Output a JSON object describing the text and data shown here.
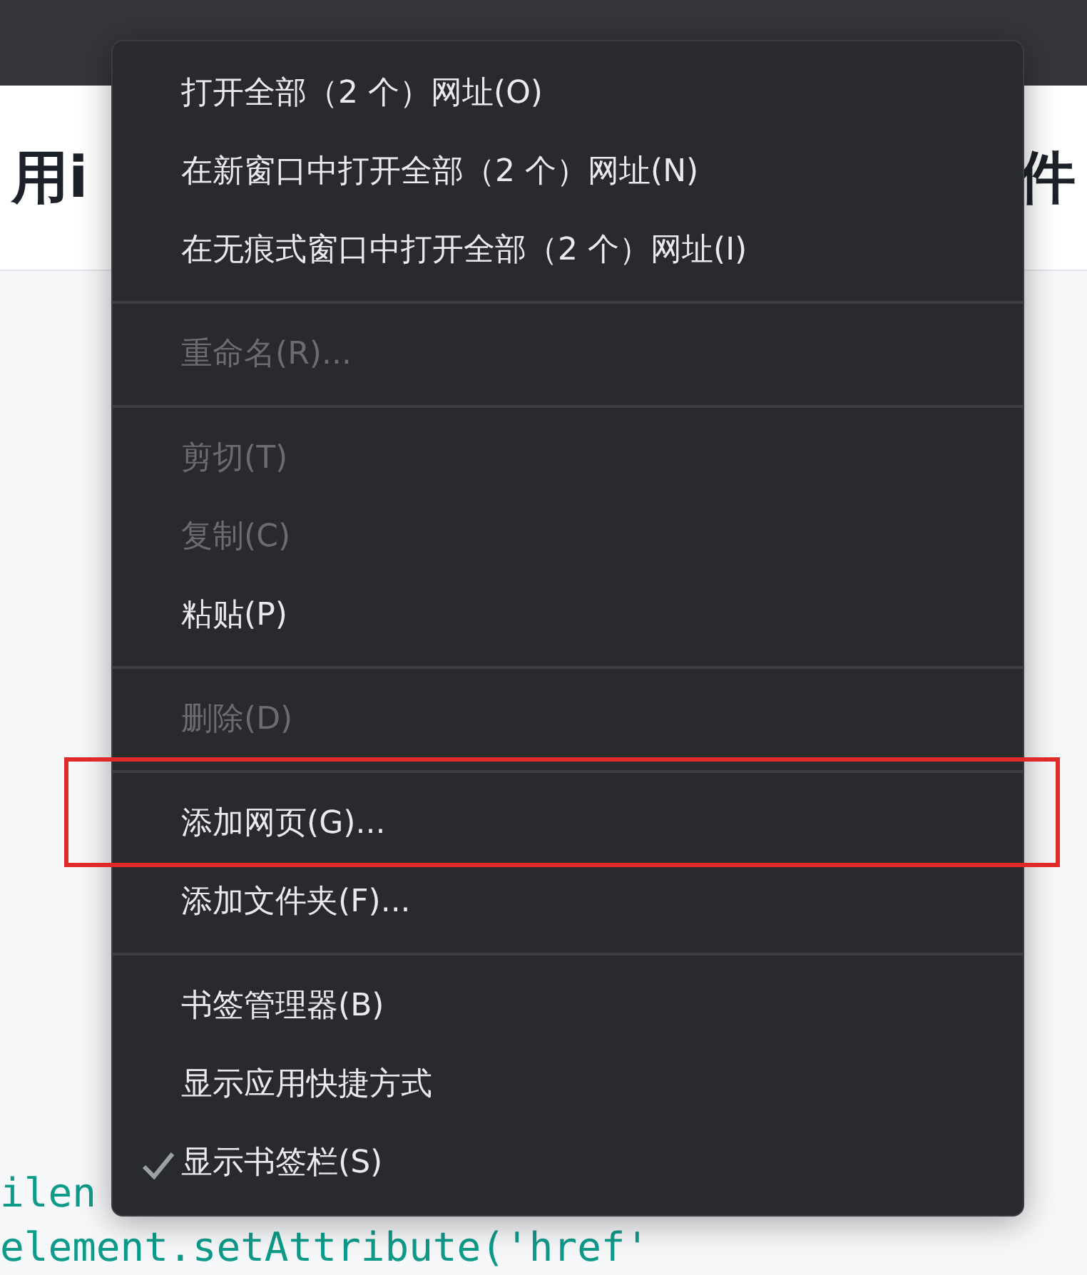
{
  "page": {
    "heading_left": "用i",
    "heading_right": "件",
    "code_lines": [
      "ilen",
      "element.setAttribute('href'"
    ]
  },
  "menu": {
    "items": [
      {
        "kind": "item",
        "label": "打开全部（2 个）网址(O)",
        "disabled": false,
        "checked": false,
        "highlighted": false
      },
      {
        "kind": "item",
        "label": "在新窗口中打开全部（2 个）网址(N)",
        "disabled": false,
        "checked": false,
        "highlighted": false
      },
      {
        "kind": "item",
        "label": "在无痕式窗口中打开全部（2 个）网址(I)",
        "disabled": false,
        "checked": false,
        "highlighted": false
      },
      {
        "kind": "separator"
      },
      {
        "kind": "item",
        "label": "重命名(R)...",
        "disabled": true,
        "checked": false,
        "highlighted": false
      },
      {
        "kind": "separator"
      },
      {
        "kind": "item",
        "label": "剪切(T)",
        "disabled": true,
        "checked": false,
        "highlighted": false
      },
      {
        "kind": "item",
        "label": "复制(C)",
        "disabled": true,
        "checked": false,
        "highlighted": false
      },
      {
        "kind": "item",
        "label": "粘贴(P)",
        "disabled": false,
        "checked": false,
        "highlighted": false
      },
      {
        "kind": "separator"
      },
      {
        "kind": "item",
        "label": "删除(D)",
        "disabled": true,
        "checked": false,
        "highlighted": false
      },
      {
        "kind": "separator"
      },
      {
        "kind": "item",
        "label": "添加网页(G)...",
        "disabled": false,
        "checked": false,
        "highlighted": true
      },
      {
        "kind": "item",
        "label": "添加文件夹(F)...",
        "disabled": false,
        "checked": false,
        "highlighted": false
      },
      {
        "kind": "separator"
      },
      {
        "kind": "item",
        "label": "书签管理器(B)",
        "disabled": false,
        "checked": false,
        "highlighted": false
      },
      {
        "kind": "item",
        "label": "显示应用快捷方式",
        "disabled": false,
        "checked": false,
        "highlighted": false
      },
      {
        "kind": "item",
        "label": "显示书签栏(S)",
        "disabled": false,
        "checked": true,
        "highlighted": false
      }
    ]
  }
}
